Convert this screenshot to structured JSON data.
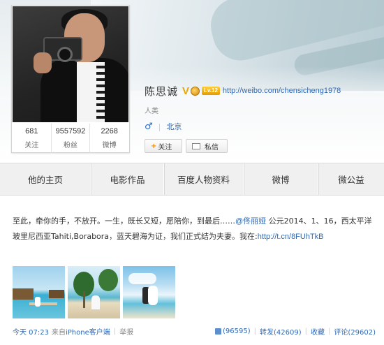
{
  "profile": {
    "name": "陈思诚",
    "verified_badge": "V",
    "level_badge": "Lv.12",
    "url": "http://weibo.com/chensicheng1978",
    "tagline": "人类",
    "gender_symbol": "♂",
    "location": "北京",
    "follow_label": "关注",
    "message_label": "私信"
  },
  "stats": [
    {
      "value": "681",
      "label": "关注"
    },
    {
      "value": "9557592",
      "label": "粉丝"
    },
    {
      "value": "2268",
      "label": "微博"
    }
  ],
  "nav": {
    "tabs": [
      {
        "label": "他的主页"
      },
      {
        "label": "电影作品"
      },
      {
        "label": "百度人物资料"
      },
      {
        "label": "微博"
      },
      {
        "label": "微公益"
      }
    ]
  },
  "post": {
    "text_before_mention": "至此，牵你的手，不放开。一生，既长又短，愿陪你，到最后……",
    "mention": "@佟丽娅",
    "text_after_mention": " 公元2014、1、16，西太平洋玻里尼西亚Tahiti,Borabora，蓝天碧海为证，我们正式结为夫妻。我在:",
    "link": "http://t.cn/8FUhTkB",
    "time": "今天 07:23",
    "source_prefix": "来自",
    "source": "iPhone客户端",
    "report": "举报",
    "likes": "(96595)",
    "repost": "转发(42609)",
    "favorite": "收藏",
    "comment": "评论(29602)"
  },
  "icons": {
    "gender": "male-icon",
    "follow": "plus-icon",
    "message": "envelope-icon",
    "like": "thumbs-up-icon",
    "medal": "medal-icon"
  },
  "colors": {
    "link": "#2f69b5",
    "verified": "#e8a600",
    "follow_plus": "#f08a00"
  }
}
